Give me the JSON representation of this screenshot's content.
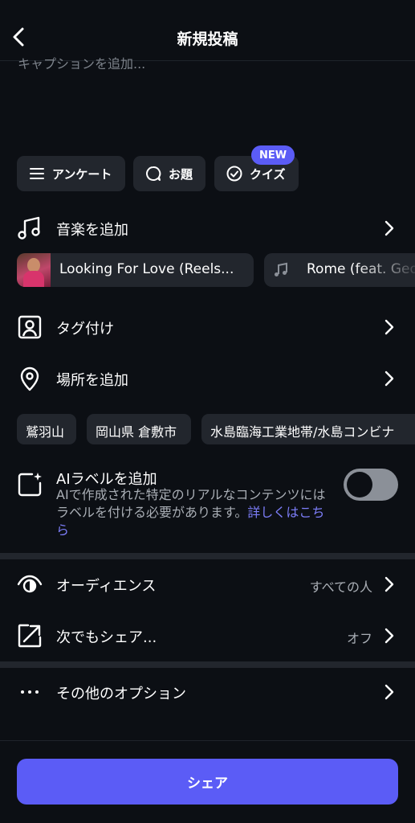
{
  "header": {
    "title": "新規投稿"
  },
  "caption": {
    "placeholder": "キャプションを追加..."
  },
  "chips": [
    {
      "label": "アンケート",
      "icon": "list-icon"
    },
    {
      "label": "お題",
      "icon": "speech-bubble-icon"
    },
    {
      "label": "クイズ",
      "icon": "check-circle-icon",
      "badge": "NEW"
    }
  ],
  "music": {
    "label": "音楽を追加",
    "suggestions": [
      {
        "title": "Looking For Love (Reels...",
        "icon": "album-thumbnail"
      },
      {
        "title": "Rome (feat. Geo",
        "icon": "music-note-icon"
      }
    ]
  },
  "tags": {
    "label": "タグ付け"
  },
  "location": {
    "label": "場所を追加",
    "suggestions": [
      "鷲羽山",
      "岡山県 倉敷市",
      "水島臨海工業地帯/水島コンビナ"
    ]
  },
  "ai_label": {
    "title": "AIラベルを追加",
    "description": "AIで作成された特定のリアルなコンテンツにはラベルを付ける必要があります。",
    "link": "詳しくはこちら",
    "enabled": false
  },
  "audience": {
    "label": "オーディエンス",
    "value": "すべての人"
  },
  "share_elsewhere": {
    "label": "次でもシェア...",
    "value": "オフ"
  },
  "more_options": {
    "label": "その他のオプション"
  },
  "footer": {
    "share_label": "シェア"
  },
  "colors": {
    "accent": "#5b5cf6",
    "background": "#0c0f14",
    "surface": "#22262d",
    "link": "#7c7df8"
  }
}
